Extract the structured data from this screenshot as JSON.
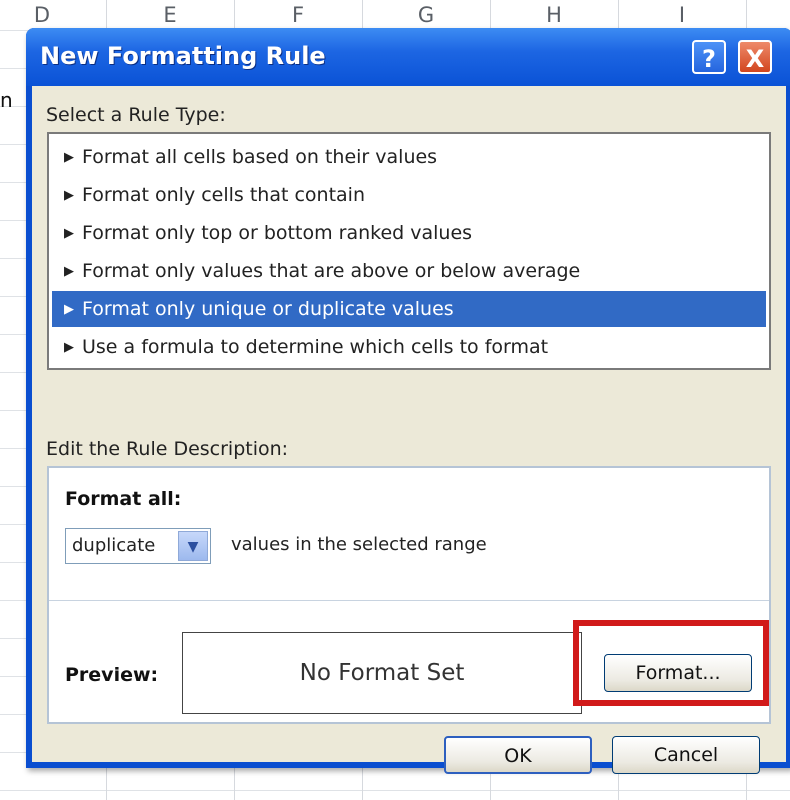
{
  "spreadsheet": {
    "column_headers": [
      "D",
      "E",
      "F",
      "G",
      "H",
      "I"
    ],
    "cell_fragment": "n"
  },
  "dialog": {
    "title": "New Formatting Rule",
    "help_button": "?",
    "close_button": "X",
    "select_rule_type_label": "Select a Rule Type:",
    "rule_types": [
      "Format all cells based on their values",
      "Format only cells that contain",
      "Format only top or bottom ranked values",
      "Format only values that are above or below average",
      "Format only unique or duplicate values",
      "Use a formula to determine which cells to format"
    ],
    "selected_rule_index": 4,
    "edit_description_label": "Edit the Rule Description:",
    "format_all_label": "Format all:",
    "format_all_select_value": "duplicate",
    "values_text": "values in the selected range",
    "preview_label": "Preview:",
    "preview_text": "No Format Set",
    "format_button": "Format...",
    "ok_button": "OK",
    "cancel_button": "Cancel"
  },
  "colors": {
    "title_bar": "#1d66e3",
    "selected_row": "#316ac5",
    "highlight_box": "#d11a1a",
    "dialog_body": "#ece9d8"
  }
}
